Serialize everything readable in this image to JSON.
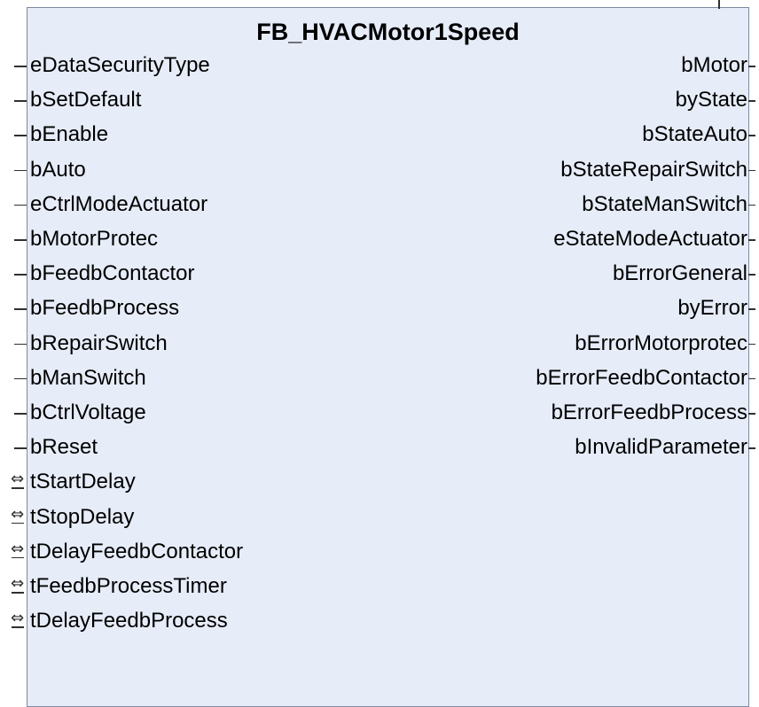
{
  "block": {
    "title": "FB_HVACMotor1Speed",
    "colors": {
      "fill": "#e6ecf8",
      "border": "#7f8aa0",
      "connector": "#303030"
    }
  },
  "inputs": [
    "eDataSecurityType",
    "bSetDefault",
    "bEnable",
    "bAuto",
    "eCtrlModeActuator",
    "bMotorProtec",
    "bFeedbContactor",
    "bFeedbProcess",
    "bRepairSwitch",
    "bManSwitch",
    "bCtrlVoltage",
    "bReset"
  ],
  "in_outs": [
    "tStartDelay",
    "tStopDelay",
    "tDelayFeedbContactor",
    "tFeedbProcessTimer",
    "tDelayFeedbProcess"
  ],
  "outputs": [
    "bMotor",
    "byState",
    "bStateAuto",
    "bStateRepairSwitch",
    "bStateManSwitch",
    "eStateModeActuator",
    "bErrorGeneral",
    "byError",
    "bErrorMotorprotec",
    "bErrorFeedbContactor",
    "bErrorFeedbProcess",
    "bInvalidParameter"
  ],
  "icons": {
    "input_pin": "line-connector-icon",
    "inout_pin": "double-arrow-icon"
  }
}
